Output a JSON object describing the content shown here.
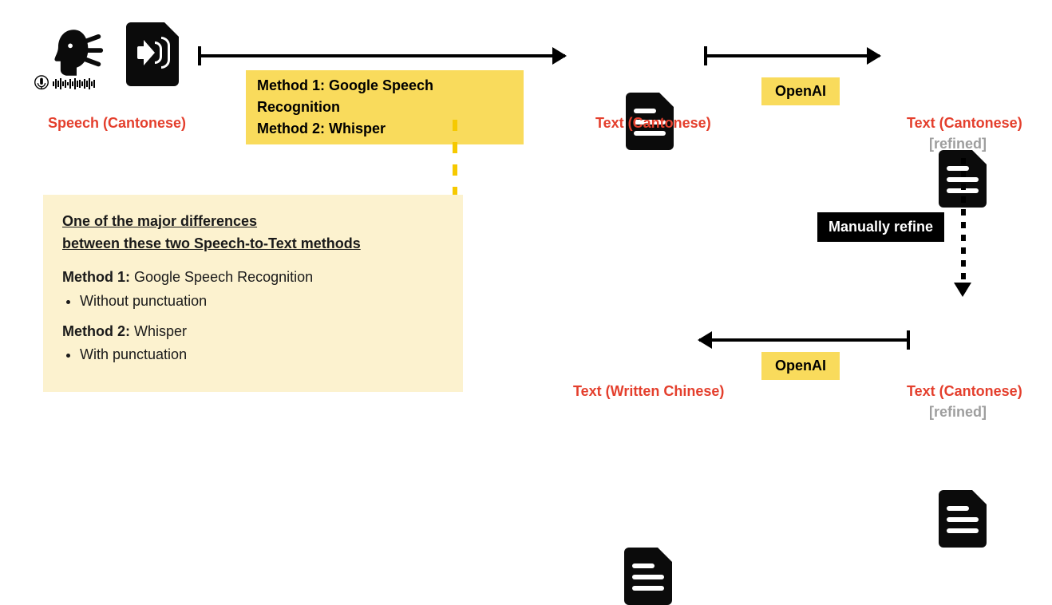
{
  "nodes": {
    "speech": {
      "label": "Speech (Cantonese)"
    },
    "text_cantonese": {
      "label": "Text (Cantonese)"
    },
    "text_cantonese_refined1": {
      "label": "Text (Cantonese)",
      "sub": "[refined]"
    },
    "text_cantonese_refined2": {
      "label": "Text (Cantonese)",
      "sub": "[refined]"
    },
    "text_written_chinese": {
      "label": "Text (Written Chinese)"
    }
  },
  "edges": {
    "stt_methods": {
      "line1_prefix": "Method 1:",
      "line1_value": " Google Speech Recognition",
      "line2_prefix": "Method 2:",
      "line2_value": " Whisper"
    },
    "openai1": {
      "label": "OpenAI"
    },
    "manual_refine": {
      "label": "Manually refine"
    },
    "openai2": {
      "label": "OpenAI"
    }
  },
  "info_box": {
    "title_line1": "One of the major differences",
    "title_line2": "between these two Speech-to-Text methods",
    "m1_prefix": "Method 1:",
    "m1_value": " Google Speech Recognition",
    "m1_bullet": "Without punctuation",
    "m2_prefix": "Method 2:",
    "m2_value": " Whisper",
    "m2_bullet": "With punctuation"
  },
  "icons": {
    "head": "speaking-head-icon",
    "mic": "microphone-icon",
    "audio_file": "audio-file-icon",
    "doc": "document-icon"
  }
}
